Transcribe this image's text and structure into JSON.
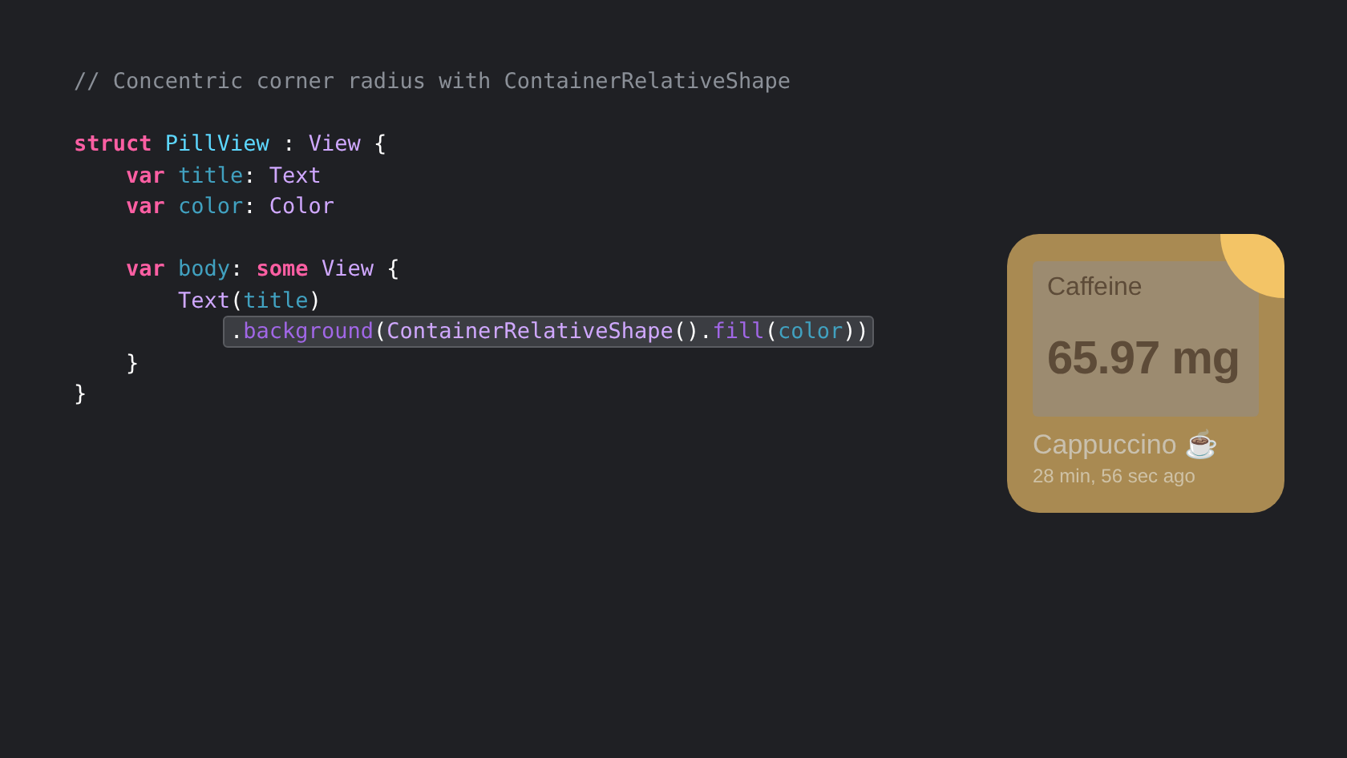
{
  "code": {
    "lines": [
      {
        "kind": "code",
        "highlighted": false,
        "tokens": [
          {
            "kind": "comment",
            "text": "// Concentric corner radius with ContainerRelativeShape"
          }
        ]
      },
      {
        "kind": "blank"
      },
      {
        "kind": "code",
        "highlighted": false,
        "tokens": [
          {
            "kind": "keyword",
            "text": "struct "
          },
          {
            "kind": "decl",
            "text": "PillView"
          },
          {
            "kind": "plain",
            "text": " : "
          },
          {
            "kind": "type",
            "text": "View"
          },
          {
            "kind": "plain",
            "text": " {"
          }
        ]
      },
      {
        "kind": "code",
        "highlighted": false,
        "tokens": [
          {
            "kind": "keyword",
            "text": "    var "
          },
          {
            "kind": "prop",
            "text": "title"
          },
          {
            "kind": "plain",
            "text": ": "
          },
          {
            "kind": "type",
            "text": "Text"
          }
        ]
      },
      {
        "kind": "code",
        "highlighted": false,
        "tokens": [
          {
            "kind": "keyword",
            "text": "    var "
          },
          {
            "kind": "prop",
            "text": "color"
          },
          {
            "kind": "plain",
            "text": ": "
          },
          {
            "kind": "type",
            "text": "Color"
          }
        ]
      },
      {
        "kind": "blank"
      },
      {
        "kind": "code",
        "highlighted": false,
        "tokens": [
          {
            "kind": "keyword",
            "text": "    var "
          },
          {
            "kind": "prop",
            "text": "body"
          },
          {
            "kind": "plain",
            "text": ": "
          },
          {
            "kind": "keyword",
            "text": "some "
          },
          {
            "kind": "type",
            "text": "View"
          },
          {
            "kind": "plain",
            "text": " {"
          }
        ]
      },
      {
        "kind": "code",
        "highlighted": false,
        "tokens": [
          {
            "kind": "type",
            "text": "        Text"
          },
          {
            "kind": "plain",
            "text": "("
          },
          {
            "kind": "prop",
            "text": "title"
          },
          {
            "kind": "plain",
            "text": ")"
          }
        ]
      },
      {
        "kind": "code",
        "highlighted": true,
        "tokens": [
          {
            "kind": "plain",
            "text": "            ."
          },
          {
            "kind": "method",
            "text": "background"
          },
          {
            "kind": "plain",
            "text": "("
          },
          {
            "kind": "type",
            "text": "ContainerRelativeShape"
          },
          {
            "kind": "plain",
            "text": "()."
          },
          {
            "kind": "method",
            "text": "fill"
          },
          {
            "kind": "plain",
            "text": "("
          },
          {
            "kind": "prop",
            "text": "color"
          },
          {
            "kind": "plain",
            "text": "))"
          }
        ]
      },
      {
        "kind": "code",
        "highlighted": false,
        "tokens": [
          {
            "kind": "plain",
            "text": "    }"
          }
        ]
      },
      {
        "kind": "code",
        "highlighted": false,
        "tokens": [
          {
            "kind": "plain",
            "text": "}"
          }
        ]
      }
    ]
  },
  "widget": {
    "label": "Caffeine",
    "value": "65.97 mg",
    "drink": "Cappuccino ☕",
    "time": "28 min, 56 sec ago"
  }
}
